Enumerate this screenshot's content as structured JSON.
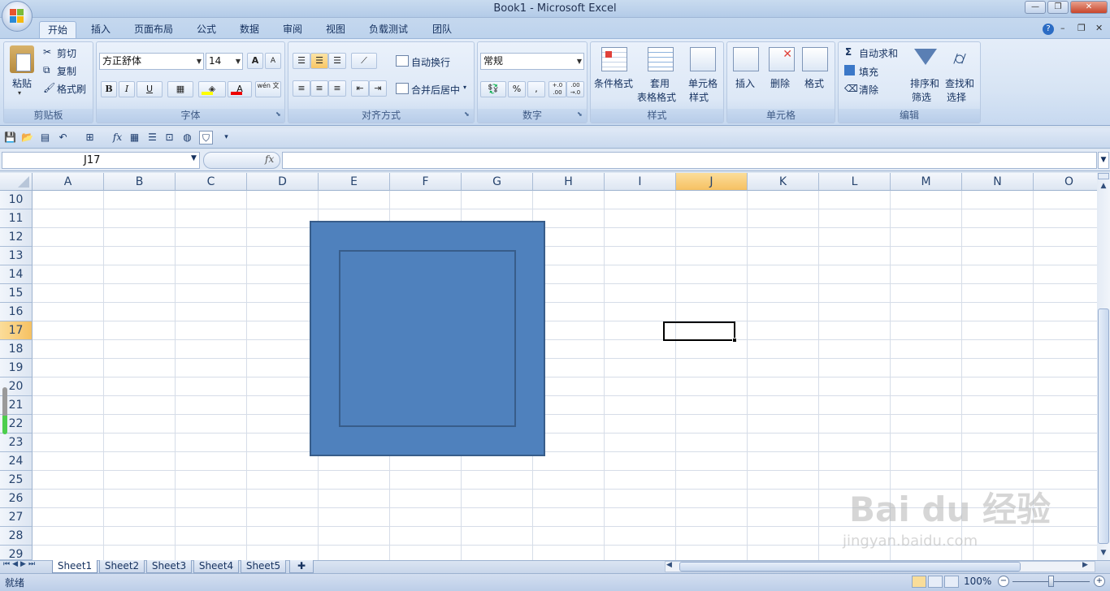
{
  "window": {
    "title": "Book1 - Microsoft Excel",
    "min": "—",
    "max": "❐",
    "close": "✕"
  },
  "tabs": [
    "开始",
    "插入",
    "页面布局",
    "公式",
    "数据",
    "审阅",
    "视图",
    "负载测试",
    "团队"
  ],
  "tab_active": "开始",
  "ribbon": {
    "clipboard": {
      "label": "剪贴板",
      "paste": "粘贴",
      "cut": "剪切",
      "copy": "复制",
      "format_painter": "格式刷"
    },
    "font": {
      "label": "字体",
      "font_name": "方正舒体",
      "font_size": "14",
      "bold": "B",
      "italic": "I",
      "underline": "U",
      "grow": "A",
      "shrink": "A",
      "font_color_glyph": "A",
      "phonetic": "wén 文"
    },
    "alignment": {
      "label": "对齐方式",
      "wrap": "自动换行",
      "merge": "合并后居中"
    },
    "number": {
      "label": "数字",
      "format": "常规",
      "percent": "%",
      "comma": ",",
      "inc_decimal": "+.0 .00",
      "dec_decimal": ".00 →.0"
    },
    "styles": {
      "label": "样式",
      "conditional": "条件格式",
      "table_format_1": "套用",
      "table_format_2": "表格格式",
      "cell_styles_1": "单元格",
      "cell_styles_2": "样式"
    },
    "cells": {
      "label": "单元格",
      "insert": "插入",
      "delete": "删除",
      "format": "格式"
    },
    "editing": {
      "label": "编辑",
      "autosum": "自动求和",
      "fill": "填充",
      "clear": "清除",
      "sort_1": "排序和",
      "sort_2": "筛选",
      "find_1": "查找和",
      "find_2": "选择",
      "sigma": "Σ"
    }
  },
  "formula_bar": {
    "name_box": "J17",
    "fx": "fx",
    "value": ""
  },
  "columns": [
    "A",
    "B",
    "C",
    "D",
    "E",
    "F",
    "G",
    "H",
    "I",
    "J",
    "K",
    "L",
    "M",
    "N",
    "O"
  ],
  "selected_column": "J",
  "rows": [
    "10",
    "11",
    "12",
    "13",
    "14",
    "15",
    "16",
    "17",
    "18",
    "19",
    "20",
    "21",
    "22",
    "23",
    "24",
    "25",
    "26",
    "27",
    "28",
    "29"
  ],
  "selected_row": "17",
  "selected_cell": "J17",
  "shape": {
    "type": "frame",
    "fill": "#4f81bd",
    "outline": "#385d8a"
  },
  "sheets": [
    "Sheet1",
    "Sheet2",
    "Sheet3",
    "Sheet4",
    "Sheet5"
  ],
  "active_sheet": "Sheet1",
  "status": {
    "ready": "就绪",
    "zoom": "100%"
  },
  "watermark": {
    "line1": "Bai du 经验",
    "line2": "jingyan.baidu.com"
  }
}
